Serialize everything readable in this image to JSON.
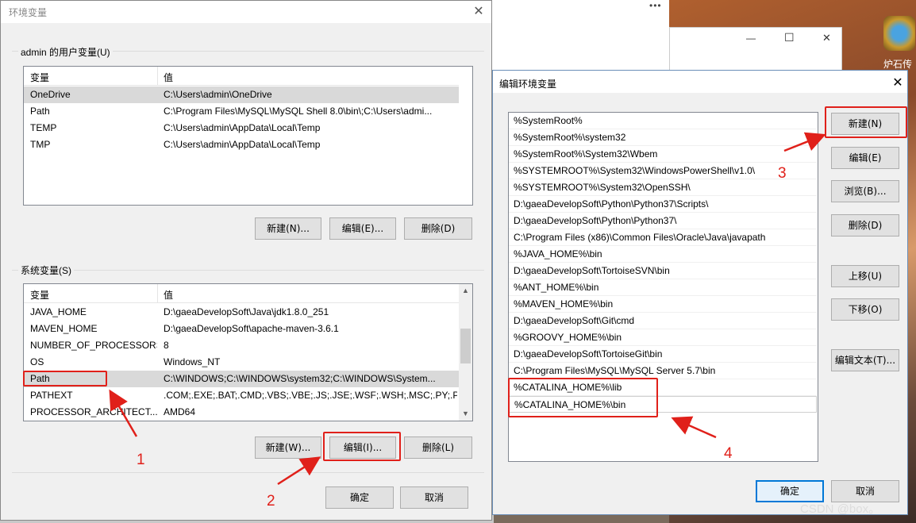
{
  "env_dialog": {
    "title": "环境变量",
    "close_glyph": "✕",
    "user_group_label": "admin 的用户变量(U)",
    "col_variable": "变量",
    "col_value": "值",
    "user_vars": [
      {
        "name": "OneDrive",
        "value": "C:\\Users\\admin\\OneDrive"
      },
      {
        "name": "Path",
        "value": "C:\\Program Files\\MySQL\\MySQL Shell 8.0\\bin\\;C:\\Users\\admi..."
      },
      {
        "name": "TEMP",
        "value": "C:\\Users\\admin\\AppData\\Local\\Temp"
      },
      {
        "name": "TMP",
        "value": "C:\\Users\\admin\\AppData\\Local\\Temp"
      }
    ],
    "user_buttons": {
      "new": "新建(N)...",
      "edit": "编辑(E)...",
      "delete": "删除(D)"
    },
    "system_group_label": "系统变量(S)",
    "system_vars": [
      {
        "name": "JAVA_HOME",
        "value": "D:\\gaeaDevelopSoft\\Java\\jdk1.8.0_251"
      },
      {
        "name": "MAVEN_HOME",
        "value": "D:\\gaeaDevelopSoft\\apache-maven-3.6.1"
      },
      {
        "name": "NUMBER_OF_PROCESSORS",
        "value": "8"
      },
      {
        "name": "OS",
        "value": "Windows_NT"
      },
      {
        "name": "Path",
        "value": "C:\\WINDOWS;C:\\WINDOWS\\system32;C:\\WINDOWS\\System..."
      },
      {
        "name": "PATHEXT",
        "value": ".COM;.EXE;.BAT;.CMD;.VBS;.VBE;.JS;.JSE;.WSF;.WSH;.MSC;.PY;.P..."
      },
      {
        "name": "PROCESSOR_ARCHITECT...",
        "value": "AMD64"
      }
    ],
    "system_buttons": {
      "new": "新建(W)...",
      "edit": "编辑(I)...",
      "delete": "删除(L)"
    },
    "ok": "确定",
    "cancel": "取消"
  },
  "edit_dialog": {
    "title": "编辑环境变量",
    "close_glyph": "✕",
    "paths": [
      "%SystemRoot%",
      "%SystemRoot%\\system32",
      "%SystemRoot%\\System32\\Wbem",
      "%SYSTEMROOT%\\System32\\WindowsPowerShell\\v1.0\\",
      "%SYSTEMROOT%\\System32\\OpenSSH\\",
      "D:\\gaeaDevelopSoft\\Python\\Python37\\Scripts\\",
      "D:\\gaeaDevelopSoft\\Python\\Python37\\",
      "C:\\Program Files (x86)\\Common Files\\Oracle\\Java\\javapath",
      "%JAVA_HOME%\\bin",
      "D:\\gaeaDevelopSoft\\TortoiseSVN\\bin",
      "%ANT_HOME%\\bin",
      "%MAVEN_HOME%\\bin",
      "D:\\gaeaDevelopSoft\\Git\\cmd",
      "%GROOVY_HOME%\\bin",
      "D:\\gaeaDevelopSoft\\TortoiseGit\\bin",
      "C:\\Program Files\\MySQL\\MySQL Server 5.7\\bin",
      "%CATALINA_HOME%\\lib",
      "%CATALINA_HOME%\\bin"
    ],
    "buttons": {
      "new": "新建(N)",
      "edit": "编辑(E)",
      "browse": "浏览(B)...",
      "delete": "删除(D)",
      "move_up": "上移(U)",
      "move_down": "下移(O)",
      "edit_text": "编辑文本(T)..."
    },
    "ok": "确定",
    "cancel": "取消"
  },
  "background": {
    "dots": "•••",
    "minimize": "—",
    "maximize": "☐",
    "close": "✕",
    "game_label": "炉石传说"
  },
  "annotations": {
    "n1": "1",
    "n2": "2",
    "n3": "3",
    "n4": "4",
    "color": "#e0201a"
  },
  "watermark": "CSDN @box。"
}
